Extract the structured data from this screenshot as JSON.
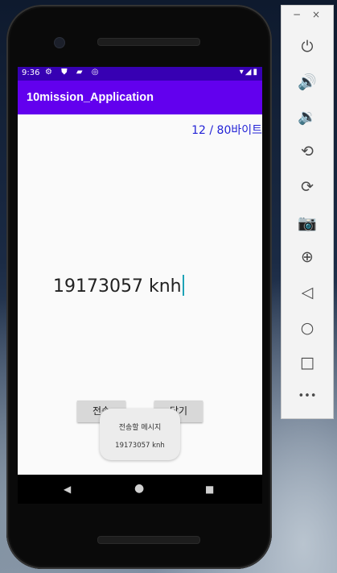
{
  "status_bar": {
    "time": "9:36",
    "left_icons": "⚙ ⛊ ▰ ◎",
    "right_icons": "▾◢▮"
  },
  "app_bar": {
    "title": "10mission_Application"
  },
  "main": {
    "byte_counter": "12 / 80바이트",
    "message_input": "19173057 knh",
    "send_button": "전송",
    "close_button": "닫기"
  },
  "toast": {
    "title": "전송할 메시지",
    "message": "19173057 knh"
  },
  "nav_bar": {
    "back": "◀",
    "home": "●",
    "recent": "■"
  },
  "emulator_toolbar": {
    "minimize": "−",
    "close": "×",
    "tools": [
      {
        "name": "power-icon",
        "glyph": "⏻"
      },
      {
        "name": "volume-up-icon",
        "glyph": "🔊"
      },
      {
        "name": "volume-down-icon",
        "glyph": "🔉"
      },
      {
        "name": "rotate-left-icon",
        "glyph": "⟲"
      },
      {
        "name": "rotate-right-icon",
        "glyph": "⟳"
      },
      {
        "name": "camera-icon",
        "glyph": "📷"
      },
      {
        "name": "zoom-icon",
        "glyph": "⊕"
      },
      {
        "name": "back-icon",
        "glyph": "◁"
      },
      {
        "name": "home-icon",
        "glyph": "○"
      },
      {
        "name": "overview-icon",
        "glyph": "□"
      },
      {
        "name": "more-icon",
        "glyph": "•••"
      }
    ]
  },
  "colors": {
    "status_bar": "#3700b3",
    "app_bar": "#6200ee",
    "byte_counter": "#2323d6",
    "cursor": "#1ea3b7"
  }
}
